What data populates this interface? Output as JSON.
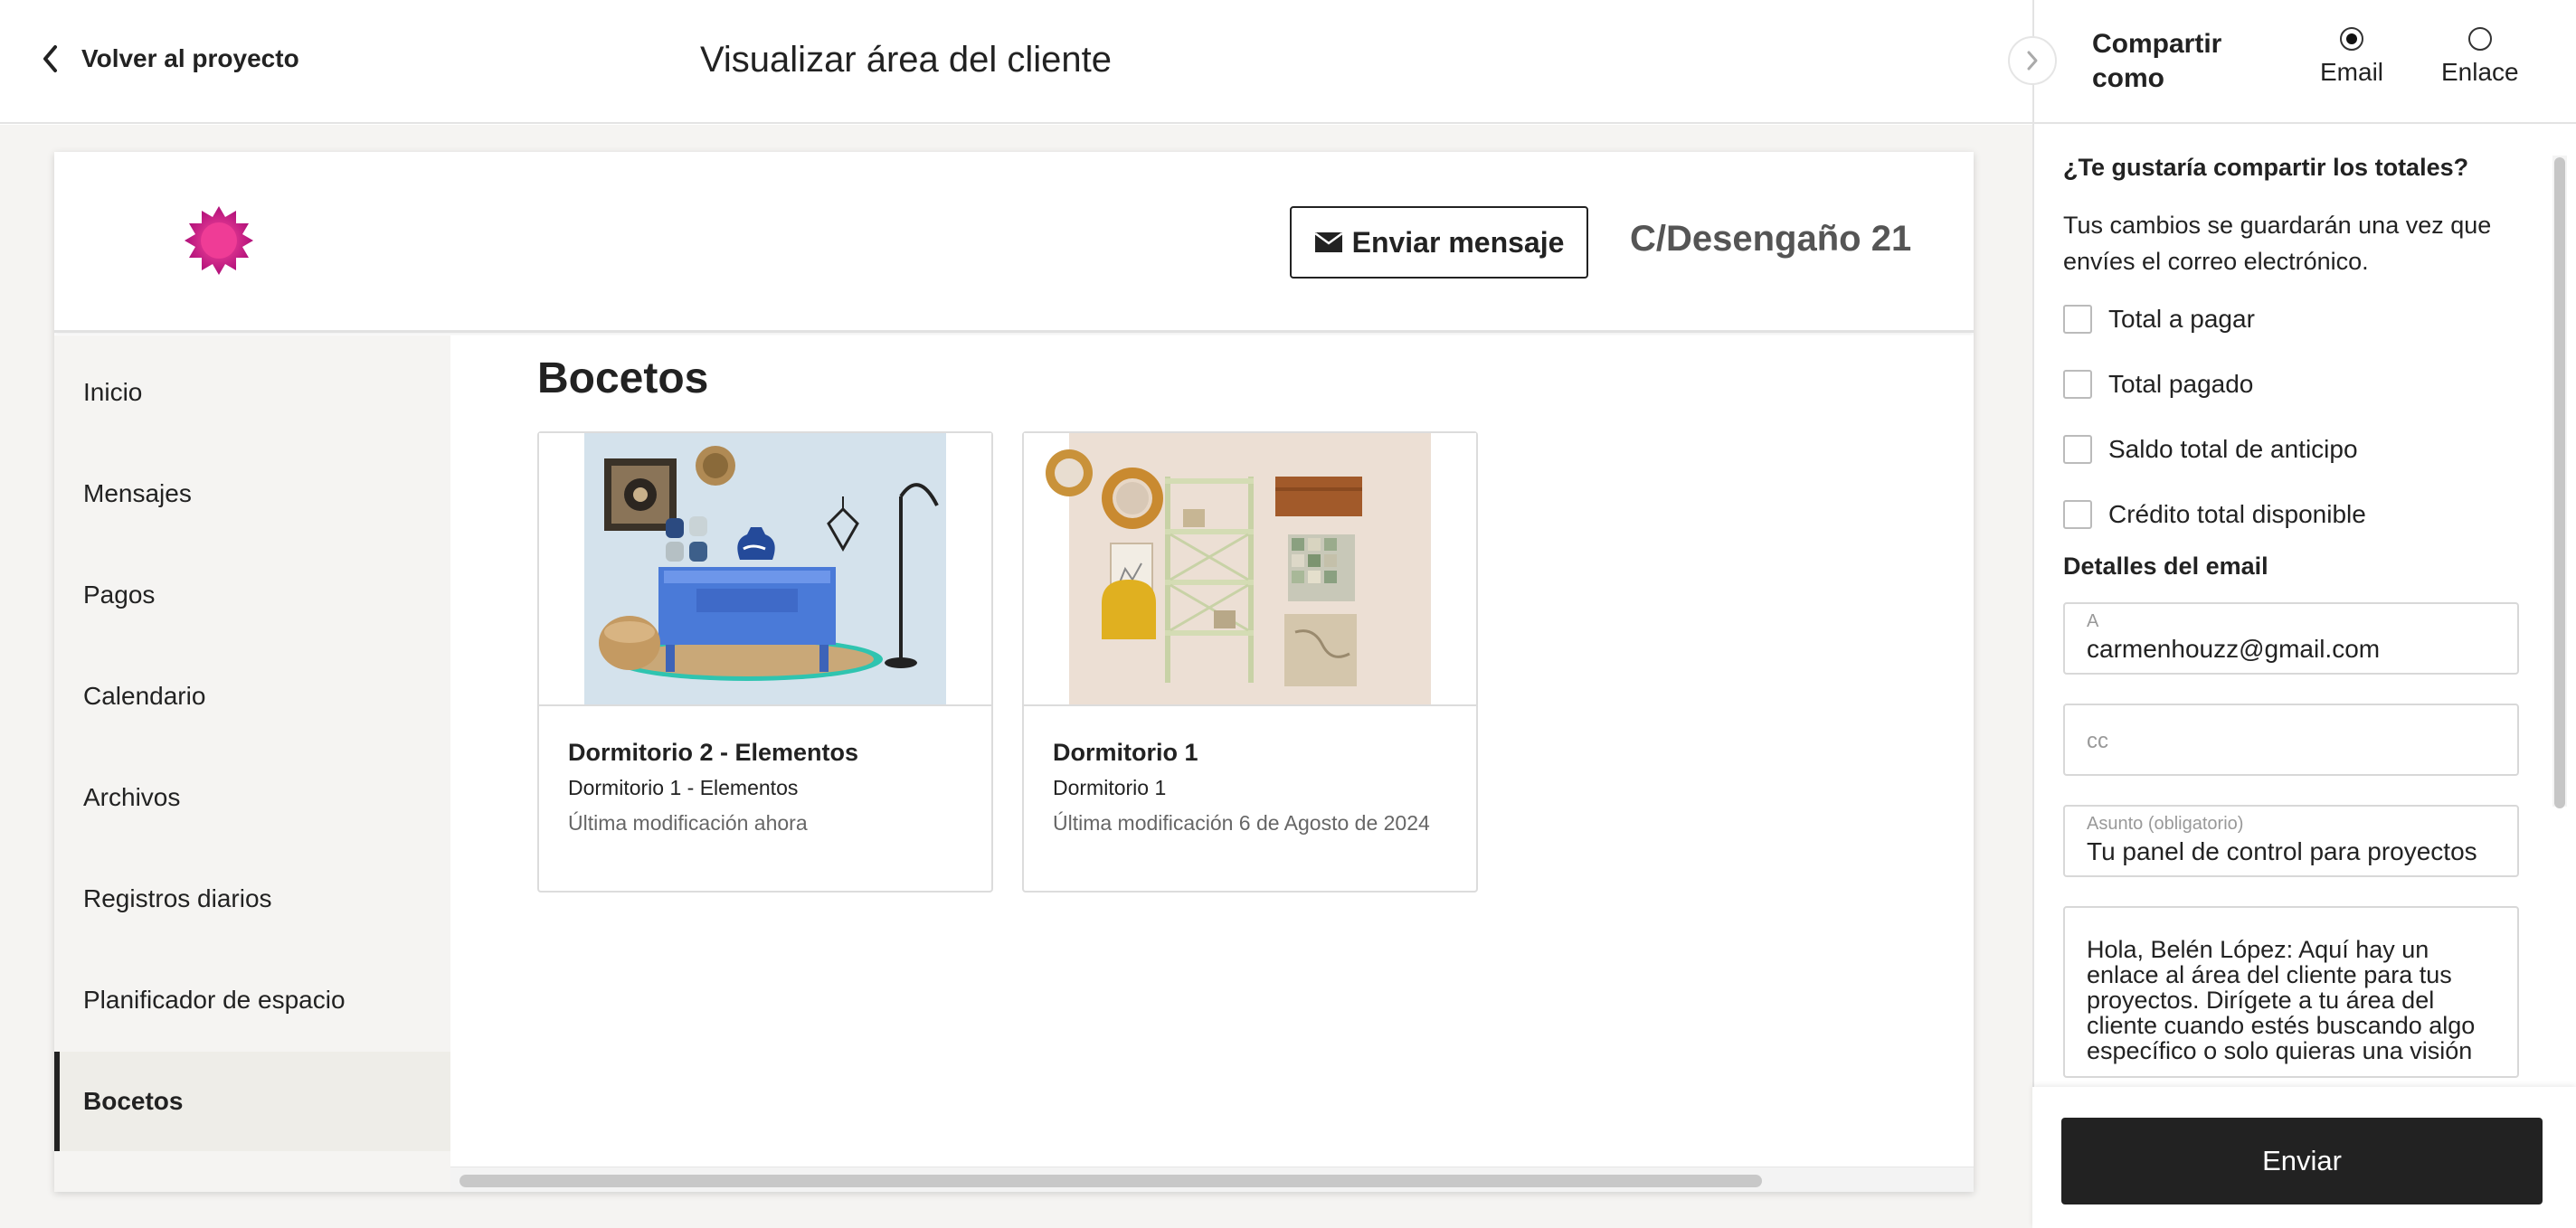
{
  "topbar": {
    "back_label": "Volver al proyecto",
    "title": "Visualizar área del cliente"
  },
  "portal": {
    "send_message_label": "Enviar mensaje",
    "address": "C/Desengaño 21",
    "logo_color": "#e0237a"
  },
  "sidebar": {
    "items": [
      {
        "label": "Inicio"
      },
      {
        "label": "Mensajes"
      },
      {
        "label": "Pagos"
      },
      {
        "label": "Calendario"
      },
      {
        "label": "Archivos"
      },
      {
        "label": "Registros diarios"
      },
      {
        "label": "Planificador de espacio"
      },
      {
        "label": "Bocetos",
        "active": true
      }
    ]
  },
  "content": {
    "section_title": "Bocetos",
    "sketches": [
      {
        "title": "Dormitorio 2 - Elementos",
        "subtitle": "Dormitorio 1 - Elementos",
        "modified": "Última modificación ahora"
      },
      {
        "title": "Dormitorio 1",
        "subtitle": "Dormitorio 1",
        "modified": "Última modificación 6 de Agosto de 2024"
      }
    ]
  },
  "panel": {
    "share_as_label": "Compartir como",
    "options": [
      {
        "label": "Email",
        "selected": true
      },
      {
        "label": "Enlace",
        "selected": false
      }
    ],
    "totals_question": "¿Te gustaría compartir los totales?",
    "save_note": "Tus cambios se guardarán una vez que envíes el correo electrónico.",
    "checkboxes": [
      {
        "label": "Total a pagar",
        "checked": false
      },
      {
        "label": "Total pagado",
        "checked": false
      },
      {
        "label": "Saldo total de anticipo",
        "checked": false
      },
      {
        "label": "Crédito total disponible",
        "checked": false
      }
    ],
    "email_details_heading": "Detalles del email",
    "to_label": "A",
    "to_value": "carmenhouzz@gmail.com",
    "cc_placeholder": "cc",
    "subject_label": "Asunto (obligatorio)",
    "subject_value": "Tu panel de control para proyectos",
    "message_value": "Hola, Belén López: Aquí hay un enlace al área del cliente para tus proyectos. Dirígete a tu área del cliente cuando estés buscando algo específico o solo quieras una visión",
    "send_label": "Enviar"
  }
}
